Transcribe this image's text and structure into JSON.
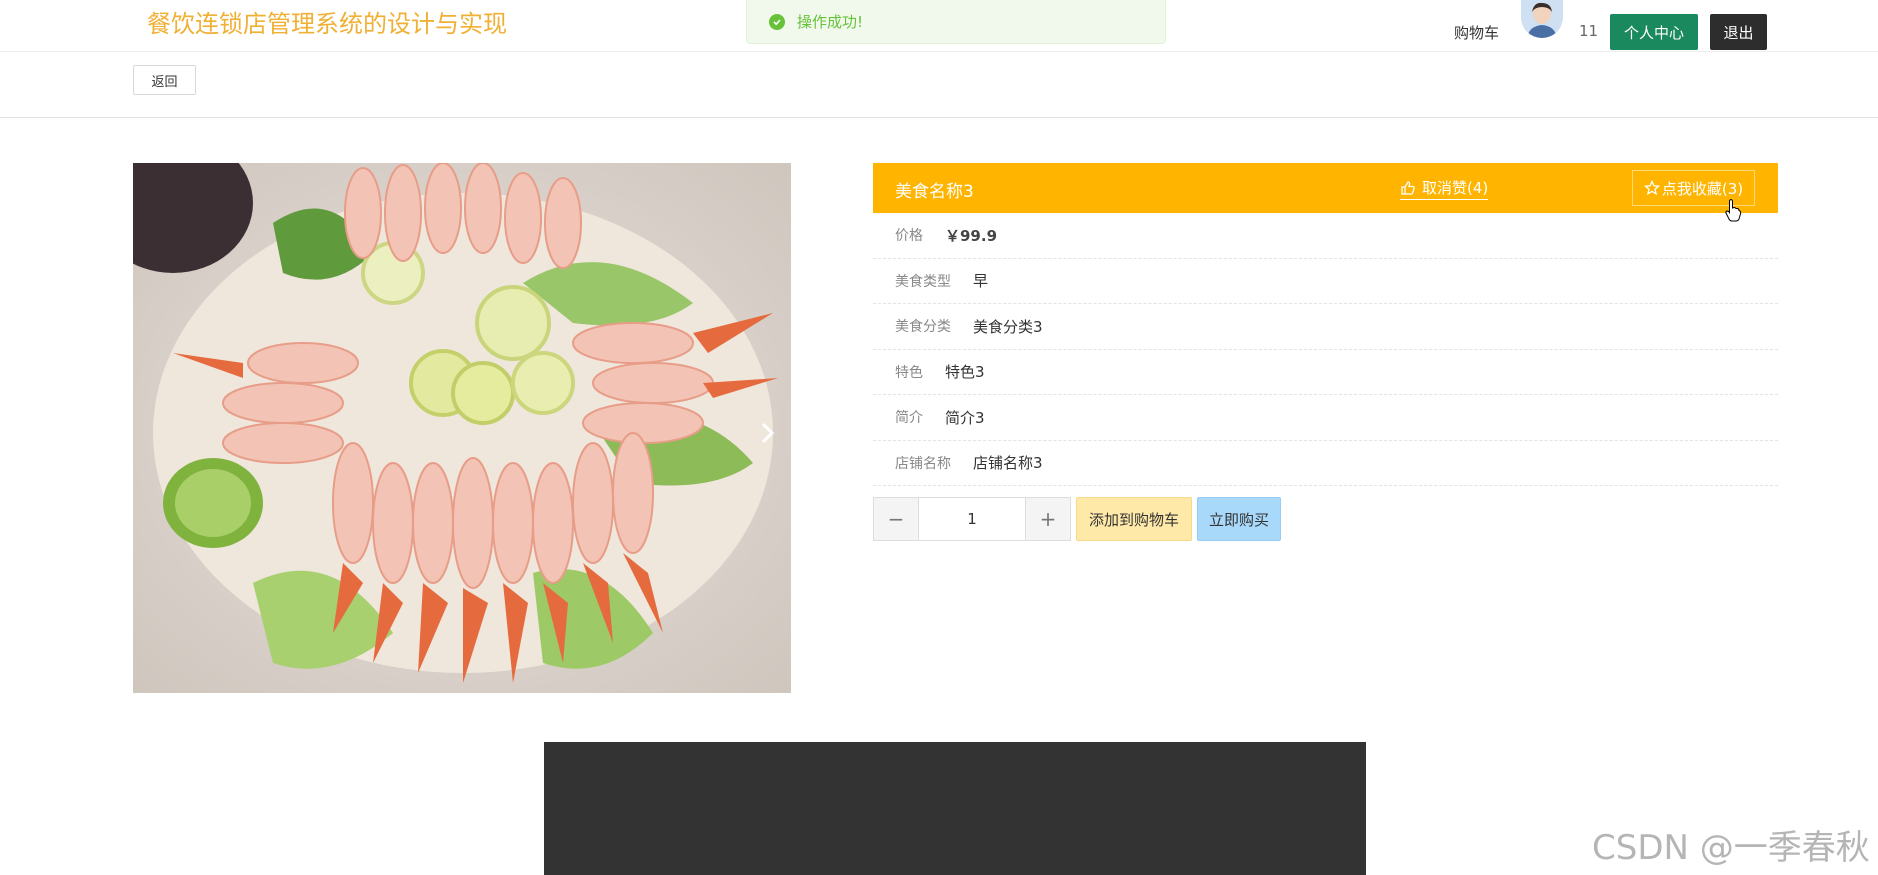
{
  "header": {
    "site_title": "餐饮连锁店管理系统的设计与实现",
    "cart_label": "购物车",
    "user_count": "11",
    "center_label": "个人中心",
    "logout_label": "退出"
  },
  "toast": {
    "message": "操作成功!",
    "icon": "check-circle-icon",
    "color": "#67c23a"
  },
  "nav": {
    "back_label": "返回"
  },
  "product": {
    "name": "美食名称3",
    "like_label": "取消赞(4)",
    "favorite_label": "点我收藏(3)",
    "header_color": "#ffb400",
    "fields": [
      {
        "label": "价格",
        "value": "￥99.9"
      },
      {
        "label": "美食类型",
        "value": "早"
      },
      {
        "label": "美食分类",
        "value": "美食分类3"
      },
      {
        "label": "特色",
        "value": "特色3"
      },
      {
        "label": "简介",
        "value": "简介3"
      },
      {
        "label": "店铺名称",
        "value": "店铺名称3"
      }
    ],
    "quantity": "1",
    "add_cart_label": "添加到购物车",
    "buy_now_label": "立即购买"
  },
  "watermark": "CSDN @一季春秋"
}
